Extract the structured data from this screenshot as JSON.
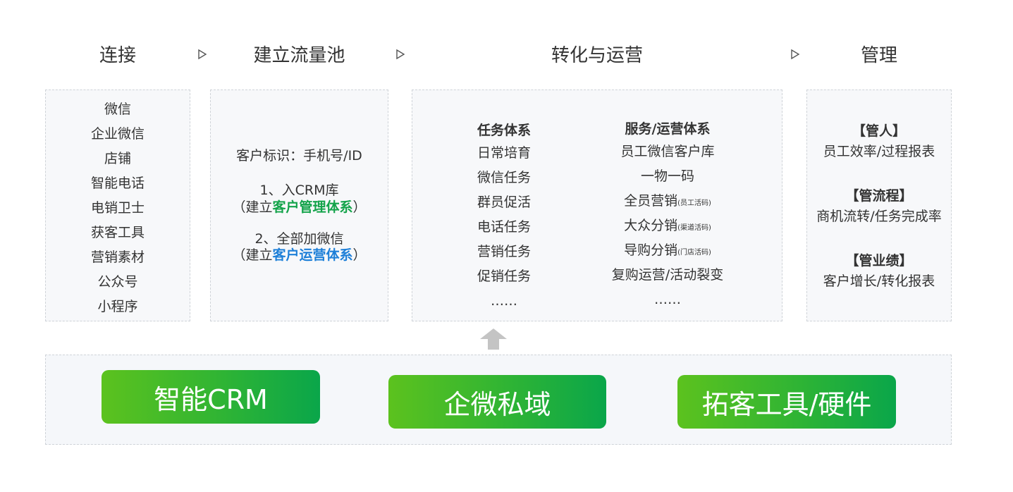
{
  "stages": {
    "connect": "连接",
    "pool": "建立流量池",
    "convert": "转化与运营",
    "manage": "管理"
  },
  "connect_items": [
    "微信",
    "企业微信",
    "店铺",
    "智能电话",
    "电销卫士",
    "获客工具",
    "营销素材",
    "公众号",
    "小程序"
  ],
  "pool": {
    "identity": "客户标识：手机号/ID",
    "step1_line1": "1、入CRM库",
    "step1_prefix": "（建立",
    "step1_highlight": "客户管理体系",
    "step1_suffix": "）",
    "step2_line1": "2、全部加微信",
    "step2_prefix": "（建立",
    "step2_highlight": "客户运营体系",
    "step2_suffix": "）"
  },
  "task_system": {
    "title": "任务体系",
    "items": [
      "日常培育",
      "微信任务",
      "群员促活",
      "电话任务",
      "营销任务",
      "促销任务",
      "……"
    ]
  },
  "service_system": {
    "title": "服务/运营体系",
    "items": [
      {
        "main": "员工微信客户库",
        "note": ""
      },
      {
        "main": "一物一码",
        "note": ""
      },
      {
        "main": "全员营销",
        "note": "(员工活码)"
      },
      {
        "main": "大众分销",
        "note": "(渠道活码)"
      },
      {
        "main": "导购分销",
        "note": "(门店活码)"
      },
      {
        "main": "复购运营/活动裂变",
        "note": ""
      },
      {
        "main": "……",
        "note": ""
      }
    ]
  },
  "management": [
    {
      "head": "【管人】",
      "body": "员工效率/过程报表"
    },
    {
      "head": "【管流程】",
      "body": "商机流转/任务完成率"
    },
    {
      "head": "【管业绩】",
      "body": "客户增长/转化报表"
    }
  ],
  "base": {
    "crm": "智能CRM",
    "wecom": "企微私域",
    "tools": "拓客工具/硬件"
  },
  "colors": {
    "green_highlight": "#13a34a",
    "blue_highlight": "#1d7fd8",
    "pill_gradient_start": "#5cc21e",
    "pill_gradient_end": "#0aa64a"
  }
}
